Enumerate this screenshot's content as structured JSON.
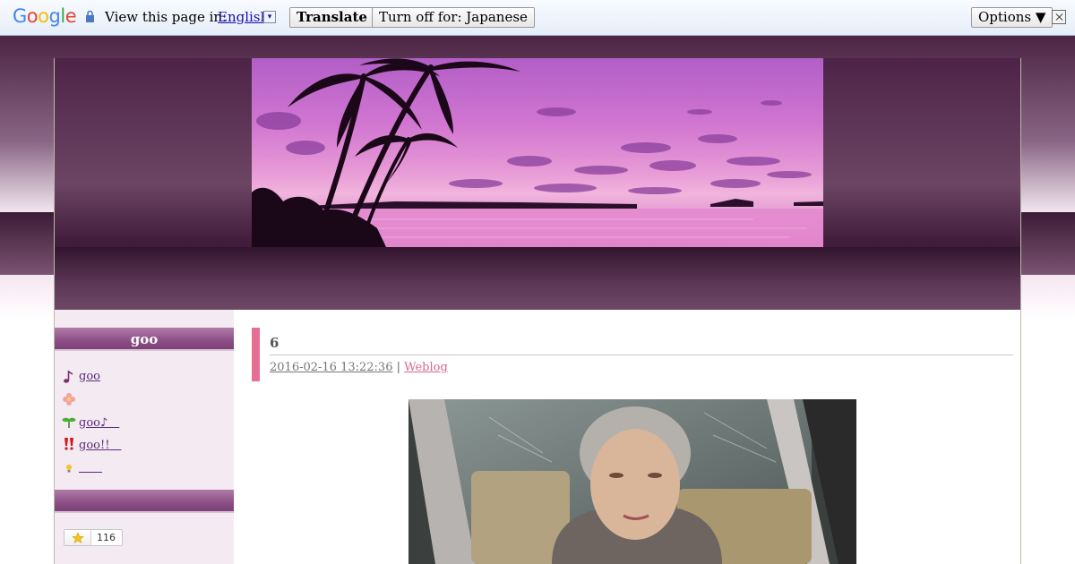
{
  "translate_bar": {
    "logo_letters": [
      {
        "ch": "G",
        "color": "#4285f4"
      },
      {
        "ch": "o",
        "color": "#ea4335"
      },
      {
        "ch": "o",
        "color": "#fbbc05"
      },
      {
        "ch": "g",
        "color": "#4285f4"
      },
      {
        "ch": "l",
        "color": "#34a853"
      },
      {
        "ch": "e",
        "color": "#ea4335"
      }
    ],
    "view_label": "View this page in:",
    "language": "English",
    "dropdown_glyph": "▾",
    "translate_button": "Translate",
    "turn_off_button": "Turn off for: Japanese",
    "options_button": "Options ▼"
  },
  "sidebar": {
    "title": "goo",
    "items": [
      {
        "icon": "music-note-icon",
        "label": "goo"
      },
      {
        "icon": "flower-icon",
        "label": ""
      },
      {
        "icon": "sprout-icon",
        "label": "goo♪　"
      },
      {
        "icon": "double-exclamation-icon",
        "label": "goo!!　"
      },
      {
        "icon": "light-bulb-icon",
        "label": "　　"
      }
    ],
    "star_count": "116"
  },
  "entry": {
    "title": "6",
    "date": "2016-02-16 13:22:36",
    "separator": "|",
    "category": "Weblog"
  },
  "colors": {
    "accent_pink": "#e56e93",
    "header_purple": "#4d2447",
    "sidebar_bar": "#8c4f86"
  }
}
